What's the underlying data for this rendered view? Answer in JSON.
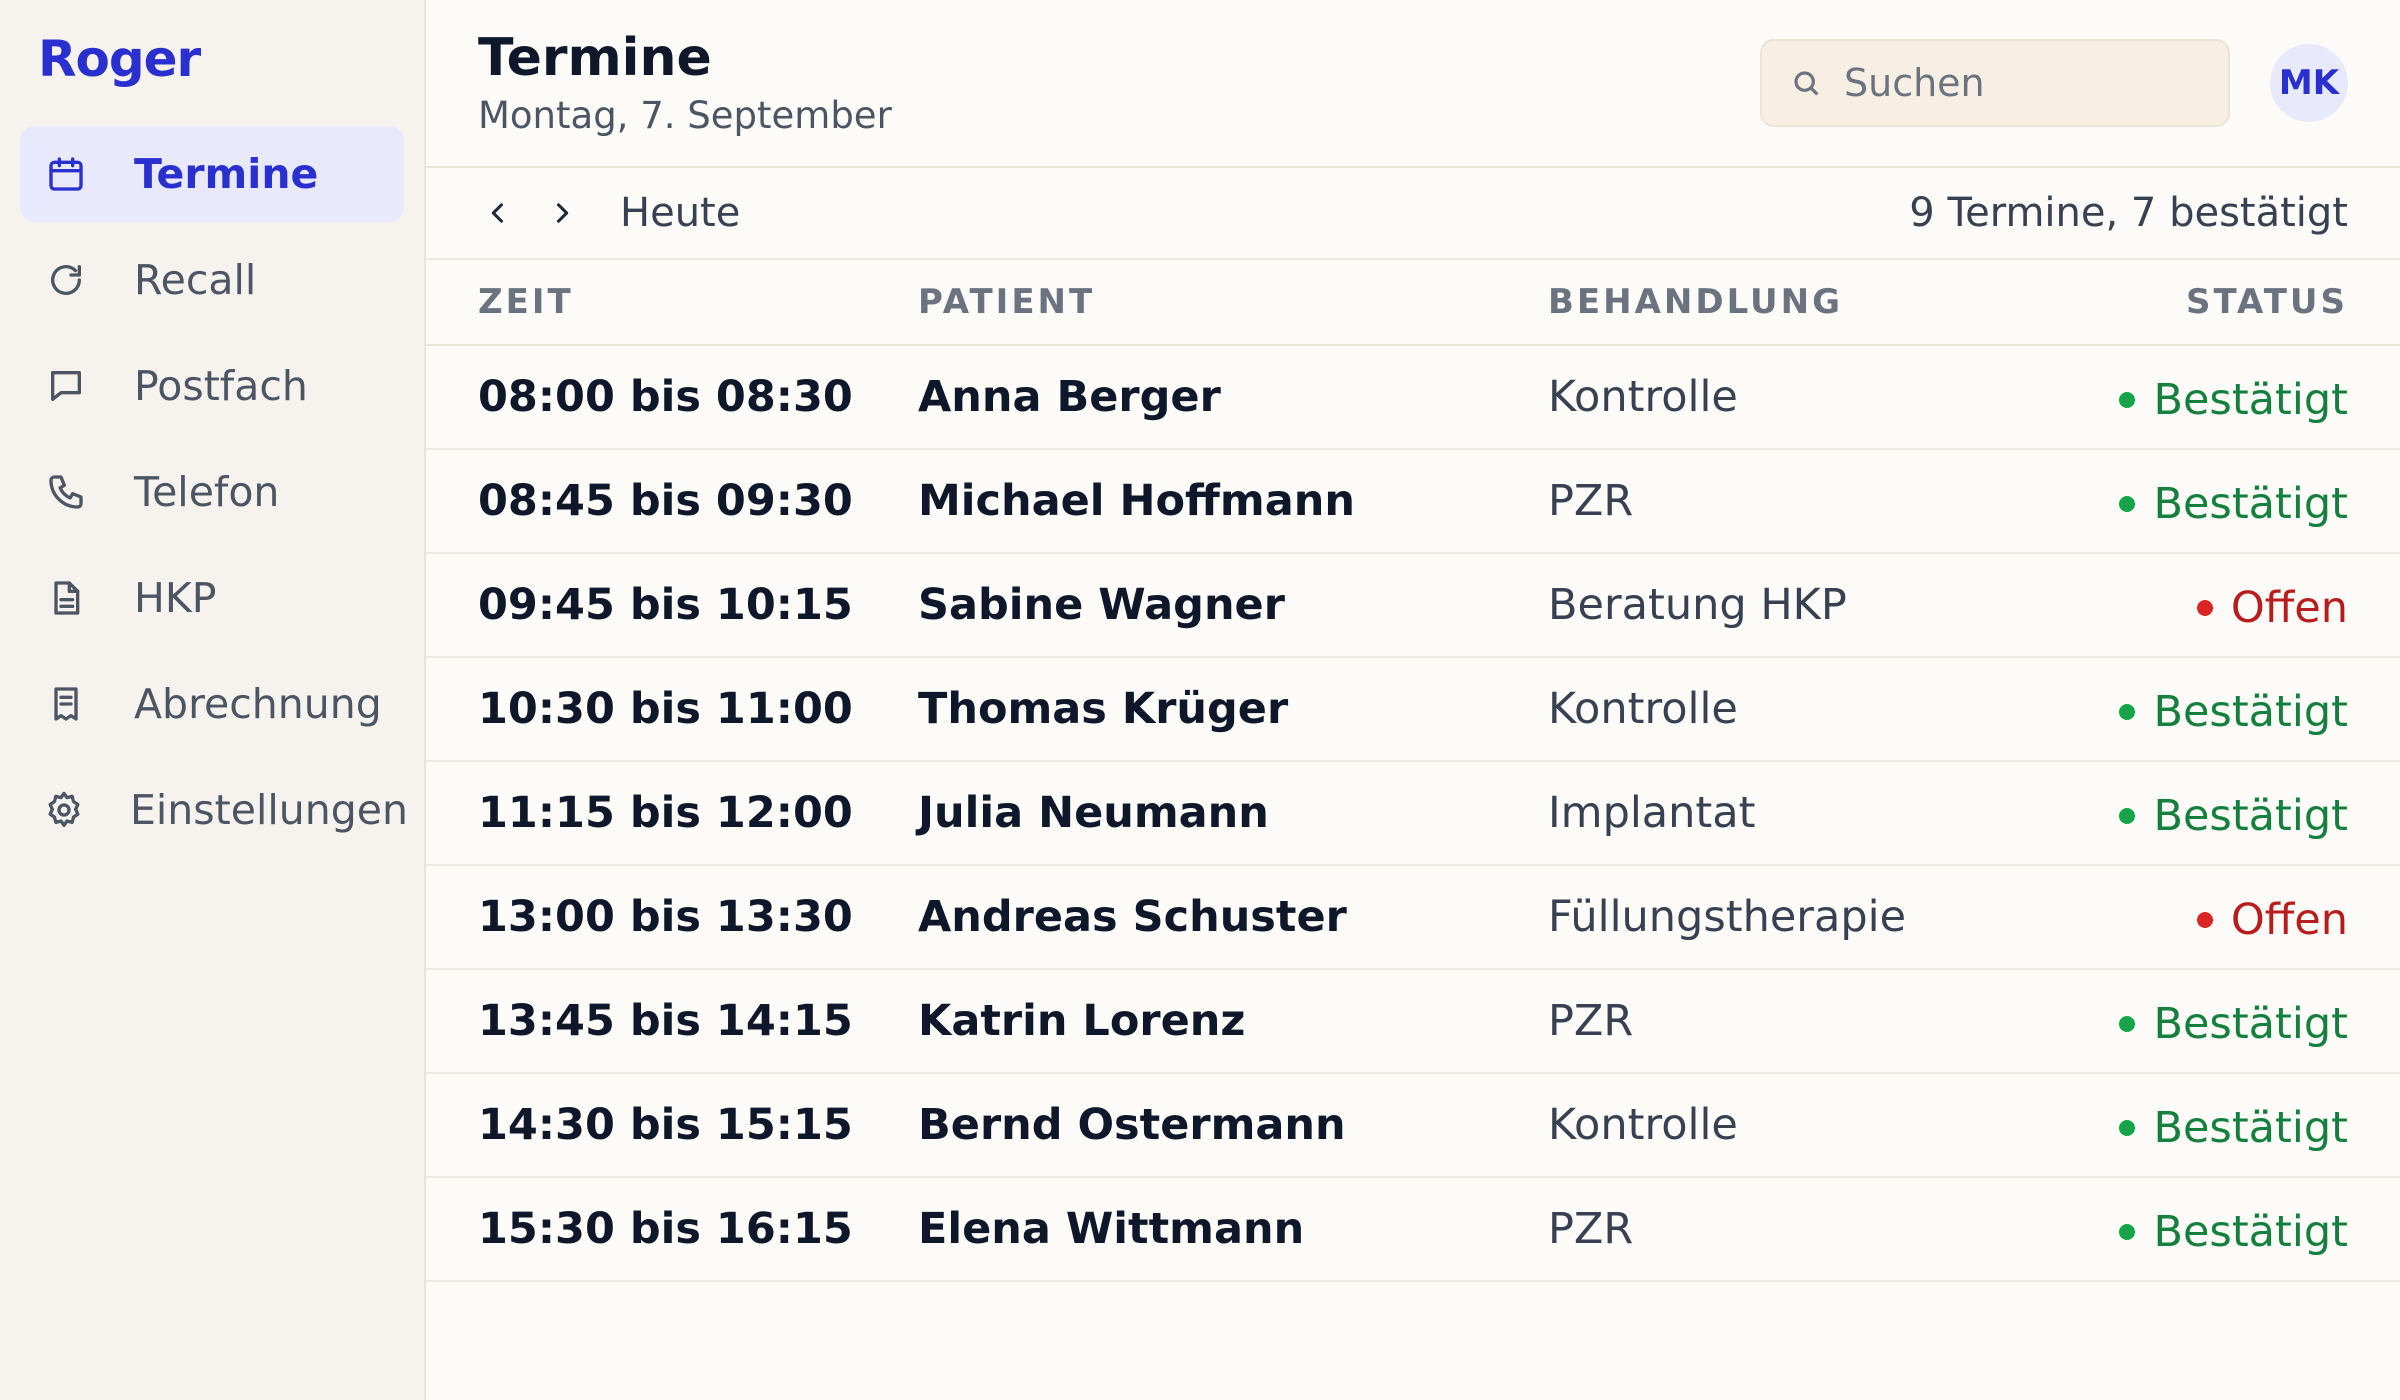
{
  "app": {
    "logo": "Roger"
  },
  "sidebar": {
    "items": [
      {
        "label": "Termine",
        "icon": "calendar-icon",
        "active": true
      },
      {
        "label": "Recall",
        "icon": "refresh-icon",
        "active": false
      },
      {
        "label": "Postfach",
        "icon": "message-icon",
        "active": false
      },
      {
        "label": "Telefon",
        "icon": "phone-icon",
        "active": false
      },
      {
        "label": "HKP",
        "icon": "document-icon",
        "active": false
      },
      {
        "label": "Abrechnung",
        "icon": "receipt-icon",
        "active": false
      },
      {
        "label": "Einstellungen",
        "icon": "gear-icon",
        "active": false
      }
    ]
  },
  "header": {
    "title": "Termine",
    "date": "Montag, 7. September",
    "search_placeholder": "Suchen",
    "avatar_initials": "MK"
  },
  "toolbar": {
    "today_label": "Heute",
    "summary": "9 Termine, 7 bestätigt"
  },
  "table": {
    "columns": {
      "time": "ZEIT",
      "patient": "PATIENT",
      "treatment": "BEHANDLUNG",
      "status": "STATUS"
    },
    "rows": [
      {
        "time": "08:00 bis 08:30",
        "patient": "Anna Berger",
        "treatment": "Kontrolle",
        "status": "Bestätigt",
        "state": "confirmed"
      },
      {
        "time": "08:45 bis 09:30",
        "patient": "Michael Hoffmann",
        "treatment": "PZR",
        "status": "Bestätigt",
        "state": "confirmed"
      },
      {
        "time": "09:45 bis 10:15",
        "patient": "Sabine Wagner",
        "treatment": "Beratung HKP",
        "status": "Offen",
        "state": "open"
      },
      {
        "time": "10:30 bis 11:00",
        "patient": "Thomas Krüger",
        "treatment": "Kontrolle",
        "status": "Bestätigt",
        "state": "confirmed"
      },
      {
        "time": "11:15 bis 12:00",
        "patient": "Julia Neumann",
        "treatment": "Implantat",
        "status": "Bestätigt",
        "state": "confirmed"
      },
      {
        "time": "13:00 bis 13:30",
        "patient": "Andreas Schuster",
        "treatment": "Füllungstherapie",
        "status": "Offen",
        "state": "open"
      },
      {
        "time": "13:45 bis 14:15",
        "patient": "Katrin Lorenz",
        "treatment": "PZR",
        "status": "Bestätigt",
        "state": "confirmed"
      },
      {
        "time": "14:30 bis 15:15",
        "patient": "Bernd Ostermann",
        "treatment": "Kontrolle",
        "status": "Bestätigt",
        "state": "confirmed"
      },
      {
        "time": "15:30 bis 16:15",
        "patient": "Elena Wittmann",
        "treatment": "PZR",
        "status": "Bestätigt",
        "state": "confirmed"
      }
    ]
  },
  "colors": {
    "accent": "#2a2fd0",
    "confirmed": "#16a34a",
    "open": "#dc2626"
  }
}
